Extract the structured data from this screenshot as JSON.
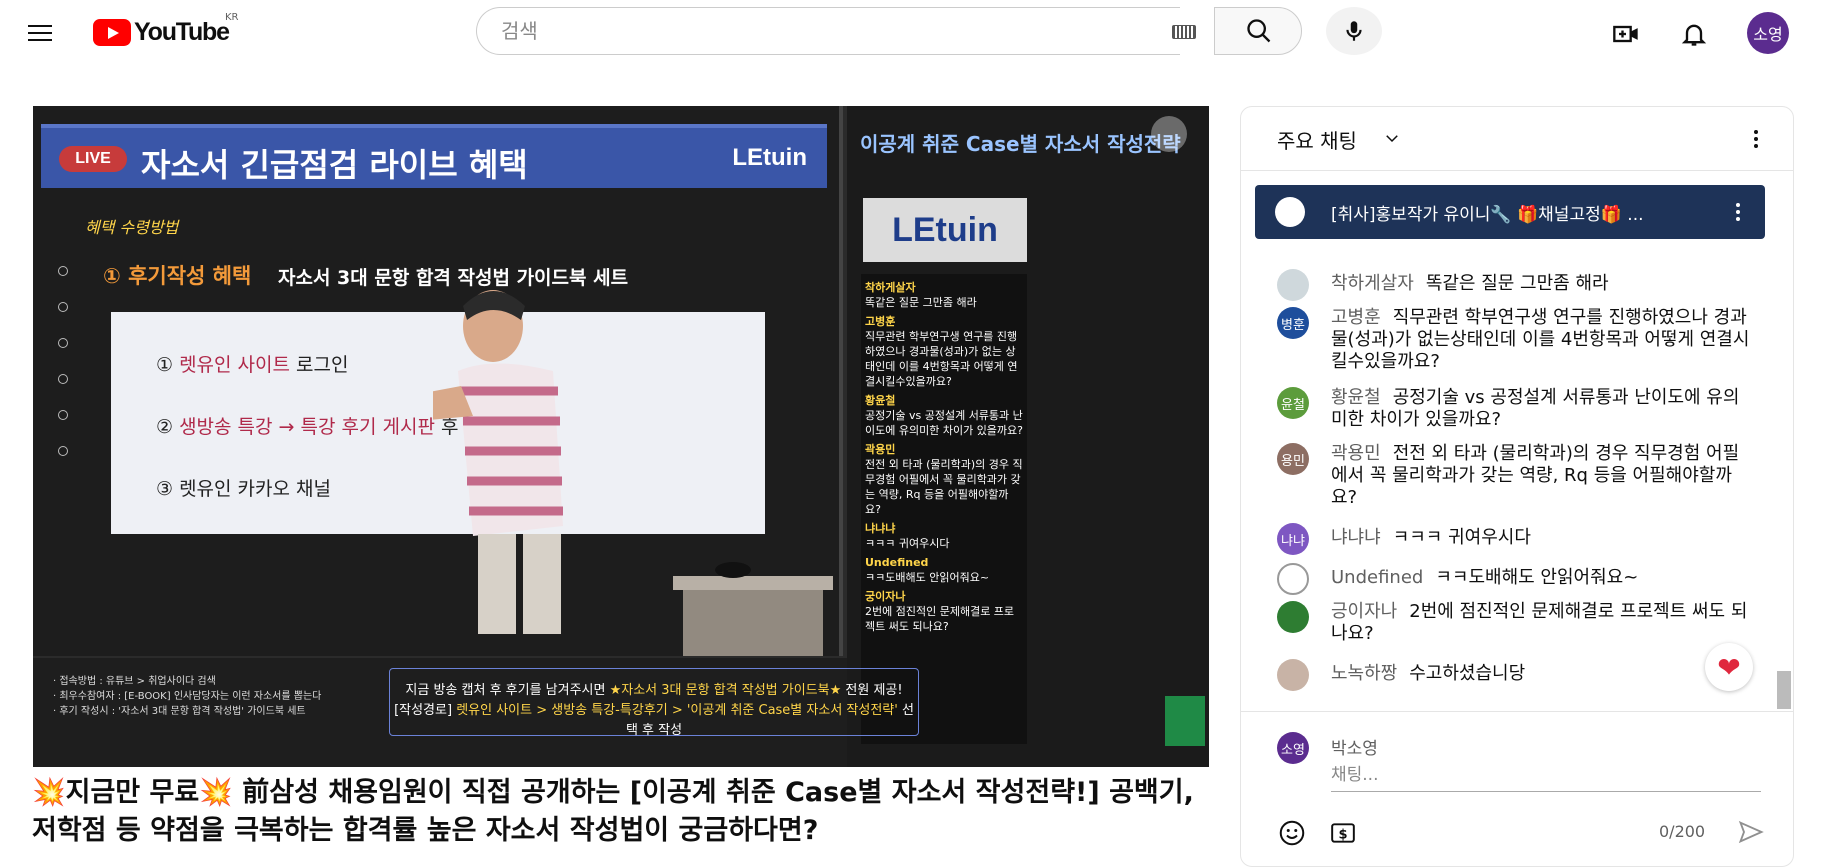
{
  "header": {
    "logo_text": "YouTube",
    "logo_country": "KR",
    "search_placeholder": "검색",
    "avatar_text": "소영"
  },
  "video": {
    "banner_live": "LIVE",
    "banner_title": "자소서 긴급점검 라이브 혜택",
    "banner_logo": "LEtuin",
    "benefit_subtitle": "혜택 수령방법",
    "step1_label": "① 후기작성 혜택",
    "step1_desc": "자소서 3대 문항 합격 작성법 가이드북 세트",
    "screen_line1_a": "① ",
    "screen_line1_b": "렛유인 사이트",
    "screen_line1_c": " 로그인",
    "screen_line2_a": "② ",
    "screen_line2_b": "생방송 특강 → 특강 후기 게시판",
    "screen_line2_c": " 후",
    "screen_line3": "③ 렛유인 카카오 채널 ",
    "side_title": "이공계 취준 Case별 자소서 작성전략",
    "side_logo": "LEtuin",
    "bottom_left_1": "· 접속방법 : 유튜브 > 취업사이다 검색",
    "bottom_left_2": "· 최우수참여자 : [E-BOOK] 인사담당자는 이런 자소서를 뽑는다",
    "bottom_left_3": "· 후기 작성시 : '자소서 3대 문항 합격 작성법' 가이드북 세트",
    "box_line1_a": "지금 방송 캡처 후 후기를 남겨주시면 ",
    "box_line1_b": "★자소서 3대 문항 합격 작성법 가이드북★",
    "box_line1_c": " 전원 제공!",
    "box_line2_a": "[작성경로] ",
    "box_line2_b": "렛유인 사이트 > 생방송 특강-특강후기 > '이공계 취준 Case별 자소서 작성전략'",
    "box_line2_c": " 선택 후 작성",
    "mini_chat": [
      {
        "name": "착하게살자",
        "text": "똑같은 질문 그만좀 해라"
      },
      {
        "name": "고병훈",
        "text": "직무관련 학부연구생 연구를 진행하였으나 경과물(성과)가 없는 상태인데 이를 4번항목과 어떻게 연결시킬수있을까요?"
      },
      {
        "name": "황윤철",
        "text": "공정기술 vs 공정설계 서류통과 난이도에 유의미한 차이가 있을까요?"
      },
      {
        "name": "곽용민",
        "text": "전전 외 타과 (물리학과)의 경우 직무경험 어필에서 꼭 물리학과가 갖는 역량, Rq 등을 어필해야할까요?"
      },
      {
        "name": "냐냐냐",
        "text": "ㅋㅋㅋ 귀여우시다"
      },
      {
        "name": "Undefined",
        "text": "ㅋㅋ도배해도 안읽어줘요~"
      },
      {
        "name": "궁이자나",
        "text": "2번에 점진적인 문제해결로 프로젝트 써도 되나요?"
      }
    ]
  },
  "video_title": "💥지금만 무료💥 前삼성 채용임원이 직접 공개하는 [이공계 취준 Case별 자소서 작성전략!] 공백기, 저학점 등 약점을 극복하는 합격률 높은 자소서 작성법이 궁금하다면?",
  "chat": {
    "header_label": "주요 채팅",
    "pinned_text": "[취사]홍보작가 유이니🔧 🎁채널고정🎁 ...",
    "messages": [
      {
        "author": "착하게살자",
        "text": "똑같은 질문 그만좀 해라",
        "avatar": "",
        "color": "#cfd8dc"
      },
      {
        "author": "고병훈",
        "text": "직무관련 학부연구생 연구를 진행하였으나 경과물(성과)가 없는상태인데 이를 4번항목과 어떻게 연결시킬수있을까요?",
        "avatar": "병훈",
        "color": "#1e4e9c"
      },
      {
        "author": "황윤철",
        "text": "공정기술 vs 공정설계 서류통과 난이도에 유의미한 차이가 있을까요?",
        "avatar": "윤철",
        "color": "#5c9c3c"
      },
      {
        "author": "곽용민",
        "text": "전전 외 타과 (물리학과)의 경우 직무경험 어필에서 꼭 물리학과가 갖는 역량, Rq 등을 어필해야할까요?",
        "avatar": "용민",
        "color": "#8d6e63"
      },
      {
        "author": "냐냐냐",
        "text": "ㅋㅋㅋ 귀여우시다",
        "avatar": "냐냐",
        "color": "#7e57c2"
      },
      {
        "author": "Undefined",
        "text": "ㅋㅋ도배해도 안읽어줘요~",
        "avatar": "",
        "color": "#ffffff"
      },
      {
        "author": "긍이자나",
        "text": "2번에 점진적인 문제해결로 프로젝트 써도 되나요?",
        "avatar": "",
        "color": "#2e7d32"
      },
      {
        "author": "노녹하짱",
        "text": "수고하셨습니당",
        "avatar": "",
        "color": "#c8b3a6"
      }
    ],
    "composer_name": "박소영",
    "composer_avatar": "소영",
    "composer_placeholder": "채팅...",
    "char_count": "0/200"
  }
}
